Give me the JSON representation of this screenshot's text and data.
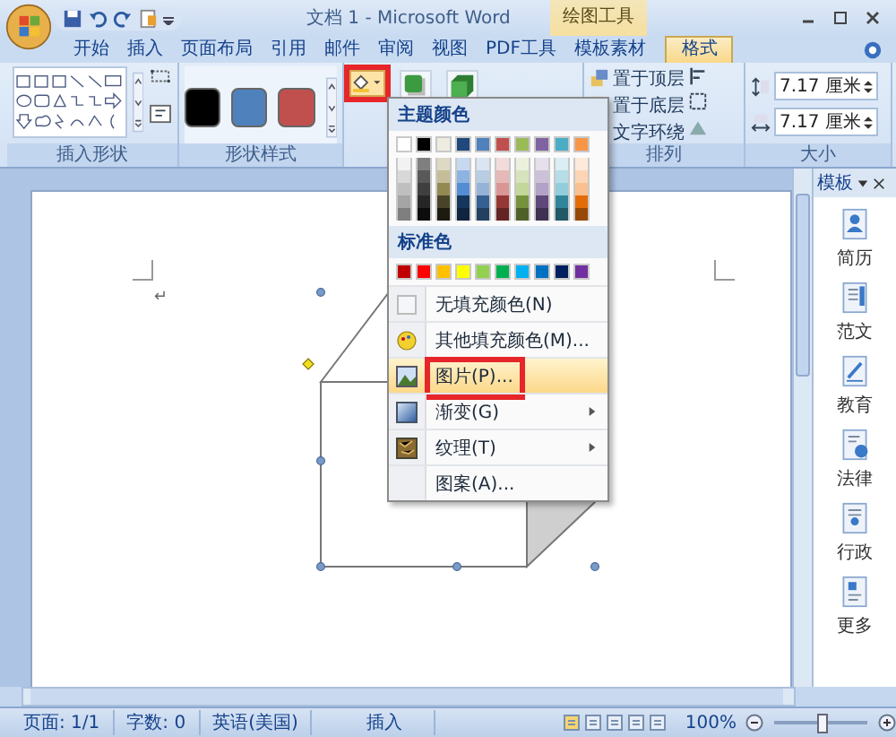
{
  "window": {
    "title": "文档 1 - Microsoft Word",
    "context_tab_group": "绘图工具"
  },
  "tabs": [
    {
      "label": "开始",
      "selected": false
    },
    {
      "label": "插入",
      "selected": false
    },
    {
      "label": "页面布局",
      "selected": false
    },
    {
      "label": "引用",
      "selected": false
    },
    {
      "label": "邮件",
      "selected": false
    },
    {
      "label": "审阅",
      "selected": false
    },
    {
      "label": "视图",
      "selected": false
    },
    {
      "label": "PDF工具",
      "selected": false
    },
    {
      "label": "模板素材",
      "selected": false
    },
    {
      "label": "格式",
      "selected": true
    }
  ],
  "ribbon": {
    "insert_shapes": {
      "label": "插入形状"
    },
    "shape_styles": {
      "label": "形状样式",
      "swatches": [
        {
          "color": "#000000"
        },
        {
          "color": "#4f81bd"
        },
        {
          "color": "#c0504d"
        }
      ]
    },
    "fill_button": {
      "marked": true
    },
    "arrange": {
      "label": "排列",
      "items": [
        "置于顶层",
        "置于底层",
        "文字环绕"
      ]
    },
    "size": {
      "label": "大小",
      "height": "7.17 厘米",
      "width": "7.17 厘米"
    }
  },
  "fill_menu": {
    "theme_header": "主题颜色",
    "theme_colors": [
      {
        "color": "#ffffff",
        "shades": [
          {
            "color": "#f2f2f2"
          },
          {
            "color": "#d8d8d8"
          },
          {
            "color": "#bfbfbf"
          },
          {
            "color": "#a5a5a5"
          },
          {
            "color": "#7f7f7f"
          }
        ]
      },
      {
        "color": "#000000",
        "shades": [
          {
            "color": "#7f7f7f"
          },
          {
            "color": "#595959"
          },
          {
            "color": "#3f3f3f"
          },
          {
            "color": "#262626"
          },
          {
            "color": "#0c0c0c"
          }
        ]
      },
      {
        "color": "#eeece1",
        "shades": [
          {
            "color": "#ddd9c3"
          },
          {
            "color": "#c4bd97"
          },
          {
            "color": "#938953"
          },
          {
            "color": "#494429"
          },
          {
            "color": "#1d1b10"
          }
        ]
      },
      {
        "color": "#1f497d",
        "shades": [
          {
            "color": "#c6d9f0"
          },
          {
            "color": "#8db3e2"
          },
          {
            "color": "#548dd4"
          },
          {
            "color": "#17365d"
          },
          {
            "color": "#0f243e"
          }
        ]
      },
      {
        "color": "#4f81bd",
        "shades": [
          {
            "color": "#dbe5f1"
          },
          {
            "color": "#b8cce4"
          },
          {
            "color": "#95b3d7"
          },
          {
            "color": "#366092"
          },
          {
            "color": "#244061"
          }
        ]
      },
      {
        "color": "#c0504d",
        "shades": [
          {
            "color": "#f2dcdb"
          },
          {
            "color": "#e5b9b7"
          },
          {
            "color": "#d99694"
          },
          {
            "color": "#953734"
          },
          {
            "color": "#632423"
          }
        ]
      },
      {
        "color": "#9bbb59",
        "shades": [
          {
            "color": "#ebf1dd"
          },
          {
            "color": "#d7e3bc"
          },
          {
            "color": "#c3d69b"
          },
          {
            "color": "#76923c"
          },
          {
            "color": "#4f6128"
          }
        ]
      },
      {
        "color": "#8064a2",
        "shades": [
          {
            "color": "#e5e0ec"
          },
          {
            "color": "#ccc1d9"
          },
          {
            "color": "#b2a2c7"
          },
          {
            "color": "#5f497a"
          },
          {
            "color": "#3f3151"
          }
        ]
      },
      {
        "color": "#4bacc6",
        "shades": [
          {
            "color": "#dbeef3"
          },
          {
            "color": "#b7dde8"
          },
          {
            "color": "#92cddc"
          },
          {
            "color": "#31859b"
          },
          {
            "color": "#205867"
          }
        ]
      },
      {
        "color": "#f79646",
        "shades": [
          {
            "color": "#fdeada"
          },
          {
            "color": "#fbd5b5"
          },
          {
            "color": "#fac08f"
          },
          {
            "color": "#e36c09"
          },
          {
            "color": "#974806"
          }
        ]
      }
    ],
    "standard_header": "标准色",
    "standard_colors": [
      {
        "color": "#c00000"
      },
      {
        "color": "#ff0000"
      },
      {
        "color": "#ffc000"
      },
      {
        "color": "#ffff00"
      },
      {
        "color": "#92d050"
      },
      {
        "color": "#00b050"
      },
      {
        "color": "#00b0f0"
      },
      {
        "color": "#0070c0"
      },
      {
        "color": "#002060"
      },
      {
        "color": "#7030a0"
      }
    ],
    "items": [
      {
        "kind": "none",
        "label": "无填充颜色(N)",
        "highlighted": false,
        "submenu": false,
        "marked": false
      },
      {
        "kind": "more",
        "label": "其他填充颜色(M)...",
        "highlighted": false,
        "submenu": false,
        "marked": false
      },
      {
        "kind": "picture",
        "label": "图片(P)...",
        "highlighted": true,
        "submenu": false,
        "marked": true
      },
      {
        "kind": "gradient",
        "label": "渐变(G)",
        "highlighted": false,
        "submenu": true,
        "marked": false
      },
      {
        "kind": "texture",
        "label": "纹理(T)",
        "highlighted": false,
        "submenu": true,
        "marked": false
      },
      {
        "kind": "pattern",
        "label": "图案(A)...",
        "highlighted": false,
        "submenu": false,
        "marked": false
      }
    ]
  },
  "document": {
    "paragraph_mark": "↵"
  },
  "task_pane": {
    "title": "模板",
    "items": [
      {
        "kind": "resume",
        "label": "简历"
      },
      {
        "kind": "sample",
        "label": "范文"
      },
      {
        "kind": "education",
        "label": "教育"
      },
      {
        "kind": "law",
        "label": "法律"
      },
      {
        "kind": "admin",
        "label": "行政"
      },
      {
        "kind": "more",
        "label": "更多"
      }
    ]
  },
  "status_bar": {
    "page": "页面: 1/1",
    "words": "字数: 0",
    "language": "英语(美国)",
    "mode": "插入",
    "zoom": "100%",
    "zoom_slider": {
      "level": 0.5
    }
  }
}
